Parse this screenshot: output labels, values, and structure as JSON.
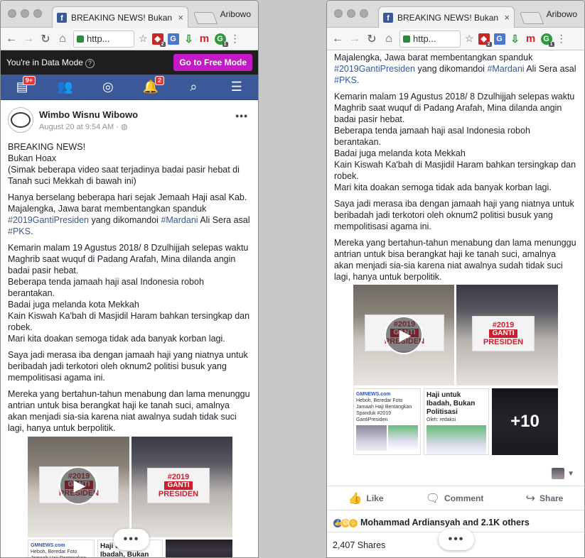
{
  "browser": {
    "tab_title": "BREAKING NEWS! Bukan Hoa",
    "tab_favicon": "f",
    "tab_close": "×",
    "profile_name": "Aribowo",
    "url_text": "http...",
    "ext_badges": {
      "e1": "2",
      "e5": "1"
    }
  },
  "data_mode": {
    "text": "You're in Data Mode",
    "button": "Go to Free Mode"
  },
  "fb_nav": {
    "feed_badge": "9+",
    "notif_badge": "2"
  },
  "post": {
    "author": "Wimbo Wisnu Wibowo",
    "timestamp": "August 20 at 9:54 AM",
    "privacy_dot": "·",
    "paragraphs": {
      "p1_l1": "BREAKING NEWS!",
      "p1_l2": "Bukan Hoax",
      "p1_l3": "(Simak beberapa video saat terjadinya badai pasir hebat di Tanah suci Mekkah di bawah ini)",
      "p2_a": "Hanya berselang beberapa hari sejak Jemaah Haji asal Kab. Majalengka, Jawa barat membentangkan spanduk ",
      "p2_tag1": "#2019GantiPresiden",
      "p2_b": " yang dikomandoi ",
      "p2_tag2": "#Mardani",
      "p2_c": " Ali Sera asal ",
      "p2_tag3": "#PKS",
      "p2_d": ".",
      "p2r_a": "Majalengka, Jawa barat membentangkan spanduk ",
      "p3_l1": "Kemarin malam 19 Agustus 2018/ 8 Dzulhijjah selepas waktu Maghrib saat wuquf di Padang Arafah, Mina dilanda angin badai pasir hebat.",
      "p3_l2": "Beberapa tenda jamaah haji asal Indonesia roboh berantakan.",
      "p3_l3": "Badai juga melanda kota Mekkah",
      "p3_l4": "Kain Kiswah Ka'bah di Masjidil Haram bahkan tersingkap dan robek.",
      "p3_l5": "Mari kita doakan semoga tidak ada banyak korban lagi.",
      "p4": "Saya jadi merasa iba dengan jamaah haji yang niatnya untuk beribadah jadi terkotori oleh oknum2 politisi busuk yang mempolitisasi agama ini.",
      "p5": "Mereka yang bertahun-tahun menabung dan lama menunggu antrian untuk bisa berangkat haji ke tanah suci, amalnya akan menjadi sia-sia karena niat awalnya sudah tidak suci lagi, hanya untuk berpolitik."
    },
    "banner": {
      "line1": "#2019",
      "line2": "GANTI",
      "line3": "PRESIDEN"
    },
    "news_card1": {
      "site": "GMNEWS.com",
      "headline": "Heboh, Beredar Foto Jamaah Haji Bentangkan Spanduk #2019 GantiPresiden"
    },
    "news_card2": {
      "title": "Haji untuk Ibadah, Bukan Politisasi",
      "by": "Oleh: redaksi"
    },
    "more_photos": "+10",
    "floating_dots": "•••"
  },
  "footer": {
    "like": "Like",
    "comment": "Comment",
    "share": "Share",
    "reactions_text": "Mohammad Ardiansyah and 2.1K others",
    "shares": "2,407 Shares"
  }
}
